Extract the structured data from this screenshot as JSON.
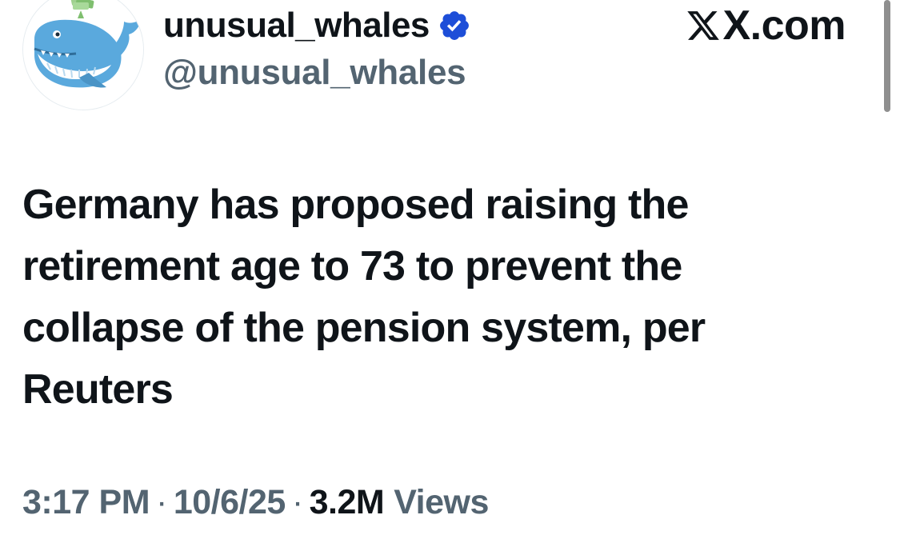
{
  "header": {
    "display_name": "unusual_whales",
    "handle": "@unusual_whales",
    "verified": true,
    "avatar_icon": "whale-avatar-icon",
    "brand": "X.com"
  },
  "tweet": {
    "text": "Germany has proposed raising the retirement age to 73 to prevent the collapse of the pension system, per Reuters"
  },
  "meta": {
    "time": "3:17 PM",
    "separator": "·",
    "date": "10/6/25",
    "views_count": "3.2M",
    "views_label": "Views"
  },
  "colors": {
    "text_primary": "#0f1419",
    "text_secondary": "#536471",
    "verified_blue": "#1d4ed8",
    "whale_blue": "#5aa9dd"
  }
}
